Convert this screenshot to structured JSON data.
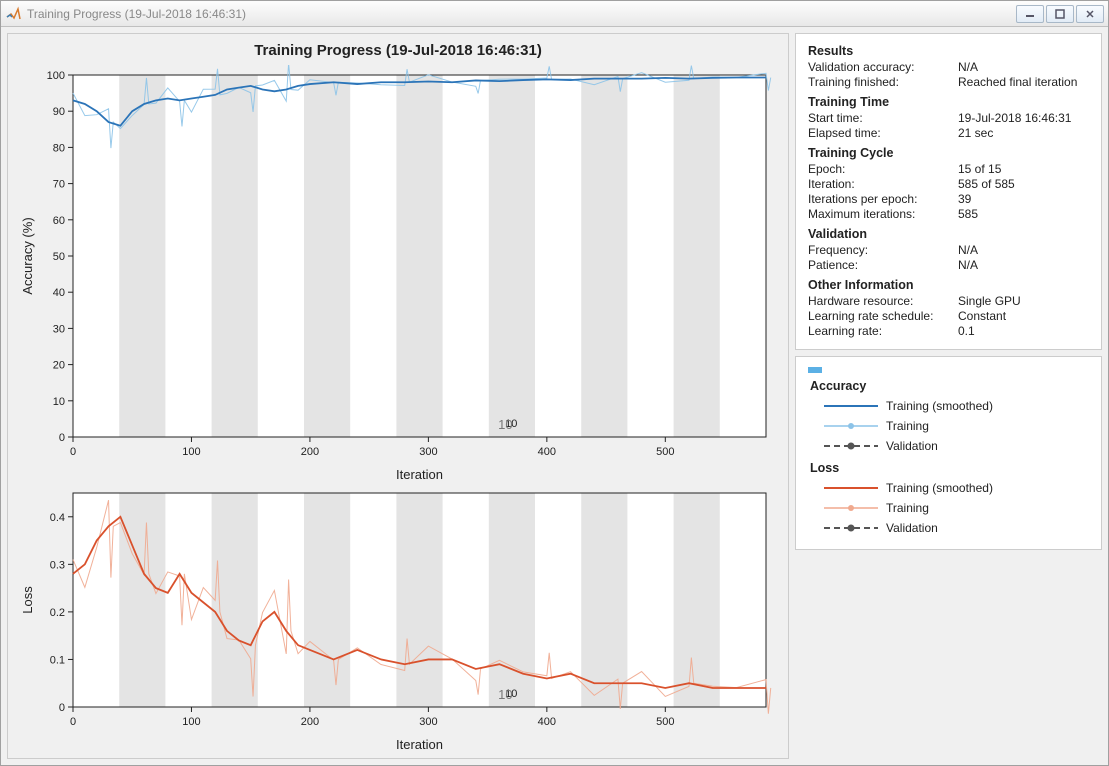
{
  "window": {
    "title": "Training Progress (19-Jul-2018 16:46:31)"
  },
  "plot_title": "Training Progress (19-Jul-2018 16:46:31)",
  "stats": {
    "results_h": "Results",
    "val_acc_l": "Validation accuracy:",
    "val_acc_v": "N/A",
    "train_fin_l": "Training finished:",
    "train_fin_v": "Reached final iteration",
    "time_h": "Training Time",
    "start_l": "Start time:",
    "start_v": "19-Jul-2018 16:46:31",
    "elapsed_l": "Elapsed time:",
    "elapsed_v": "21 sec",
    "cycle_h": "Training Cycle",
    "epoch_l": "Epoch:",
    "epoch_v": "15 of 15",
    "iter_l": "Iteration:",
    "iter_v": "585 of 585",
    "ipe_l": "Iterations per epoch:",
    "ipe_v": "39",
    "maxiter_l": "Maximum iterations:",
    "maxiter_v": "585",
    "valid_h": "Validation",
    "freq_l": "Frequency:",
    "freq_v": "N/A",
    "pat_l": "Patience:",
    "pat_v": "N/A",
    "other_h": "Other Information",
    "hw_l": "Hardware resource:",
    "hw_v": "Single GPU",
    "lrs_l": "Learning rate schedule:",
    "lrs_v": "Constant",
    "lr_l": "Learning rate:",
    "lr_v": "0.1"
  },
  "legend": {
    "acc_h": "Accuracy",
    "train_sm": "Training (smoothed)",
    "train": "Training",
    "val": "Validation",
    "loss_h": "Loss"
  },
  "chart_data": [
    {
      "type": "line",
      "title": "Accuracy",
      "xlabel": "Iteration",
      "ylabel": "Accuracy (%)",
      "xlim": [
        0,
        585
      ],
      "ylim": [
        0,
        100
      ],
      "xticks": [
        0,
        100,
        200,
        300,
        400,
        500
      ],
      "yticks": [
        0,
        10,
        20,
        30,
        40,
        50,
        60,
        70,
        80,
        90,
        100
      ],
      "epoch_annotation": "10",
      "epoch_boundaries": [
        39,
        78,
        117,
        156,
        195,
        234,
        273,
        312,
        351,
        390,
        429,
        468,
        507,
        546,
        585
      ],
      "series": [
        {
          "name": "Training (smoothed)",
          "color": "#2b74b8",
          "values": [
            [
              0,
              93
            ],
            [
              10,
              92
            ],
            [
              20,
              90
            ],
            [
              30,
              87
            ],
            [
              40,
              86
            ],
            [
              50,
              90
            ],
            [
              60,
              92
            ],
            [
              70,
              93
            ],
            [
              80,
              93.5
            ],
            [
              90,
              93
            ],
            [
              100,
              93.5
            ],
            [
              110,
              94
            ],
            [
              120,
              94.5
            ],
            [
              130,
              96
            ],
            [
              140,
              96.5
            ],
            [
              150,
              97
            ],
            [
              160,
              96
            ],
            [
              170,
              95.5
            ],
            [
              180,
              96
            ],
            [
              190,
              97
            ],
            [
              200,
              97.5
            ],
            [
              220,
              98
            ],
            [
              240,
              97.5
            ],
            [
              260,
              98
            ],
            [
              280,
              98
            ],
            [
              300,
              98.2
            ],
            [
              320,
              98
            ],
            [
              340,
              98.5
            ],
            [
              360,
              98.3
            ],
            [
              380,
              98.6
            ],
            [
              400,
              98.8
            ],
            [
              420,
              98.6
            ],
            [
              440,
              99
            ],
            [
              460,
              99
            ],
            [
              480,
              99
            ],
            [
              500,
              99.2
            ],
            [
              520,
              99
            ],
            [
              540,
              99.2
            ],
            [
              560,
              99.3
            ],
            [
              585,
              99.3
            ]
          ]
        },
        {
          "name": "Training",
          "color": "#8cc3e8",
          "noisy": true
        }
      ]
    },
    {
      "type": "line",
      "title": "Loss",
      "xlabel": "Iteration",
      "ylabel": "Loss",
      "xlim": [
        0,
        585
      ],
      "ylim": [
        0,
        0.45
      ],
      "xticks": [
        0,
        100,
        200,
        300,
        400,
        500
      ],
      "yticks": [
        0,
        0.1,
        0.2,
        0.3,
        0.4
      ],
      "epoch_annotation": "10",
      "series": [
        {
          "name": "Training (smoothed)",
          "color": "#d9512c",
          "values": [
            [
              0,
              0.28
            ],
            [
              10,
              0.3
            ],
            [
              20,
              0.35
            ],
            [
              30,
              0.38
            ],
            [
              40,
              0.4
            ],
            [
              50,
              0.34
            ],
            [
              60,
              0.28
            ],
            [
              70,
              0.25
            ],
            [
              80,
              0.24
            ],
            [
              90,
              0.28
            ],
            [
              100,
              0.24
            ],
            [
              110,
              0.22
            ],
            [
              120,
              0.2
            ],
            [
              130,
              0.16
            ],
            [
              140,
              0.14
            ],
            [
              150,
              0.13
            ],
            [
              160,
              0.18
            ],
            [
              170,
              0.2
            ],
            [
              180,
              0.16
            ],
            [
              190,
              0.13
            ],
            [
              200,
              0.12
            ],
            [
              220,
              0.1
            ],
            [
              240,
              0.12
            ],
            [
              260,
              0.1
            ],
            [
              280,
              0.09
            ],
            [
              300,
              0.1
            ],
            [
              320,
              0.1
            ],
            [
              340,
              0.08
            ],
            [
              360,
              0.09
            ],
            [
              380,
              0.07
            ],
            [
              400,
              0.06
            ],
            [
              420,
              0.07
            ],
            [
              440,
              0.05
            ],
            [
              460,
              0.05
            ],
            [
              480,
              0.05
            ],
            [
              500,
              0.04
            ],
            [
              520,
              0.05
            ],
            [
              540,
              0.04
            ],
            [
              560,
              0.04
            ],
            [
              585,
              0.04
            ]
          ]
        },
        {
          "name": "Training",
          "color": "#f0a98e",
          "noisy": true
        }
      ]
    }
  ]
}
